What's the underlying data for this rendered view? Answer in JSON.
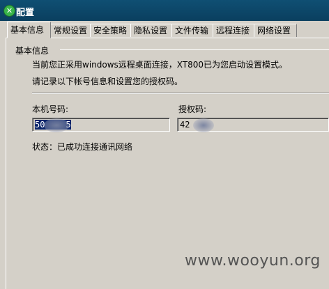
{
  "window": {
    "title": "配置"
  },
  "tabs": [
    {
      "label": "基本信息",
      "active": true
    },
    {
      "label": "常规设置",
      "active": false
    },
    {
      "label": "安全策略",
      "active": false
    },
    {
      "label": "隐私设置",
      "active": false
    },
    {
      "label": "文件传输",
      "active": false
    },
    {
      "label": "远程连接",
      "active": false
    },
    {
      "label": "网络设置",
      "active": false
    }
  ],
  "basic_info": {
    "group_title": "基本信息",
    "notice_line1": "当前您正采用windows远程桌面连接，XT800已为您启动设置模式。",
    "notice_line2": "请记录以下帐号信息和设置您的授权码。",
    "machine_code_label": "本机号码:",
    "machine_code_value_start": "50",
    "machine_code_value_end": "5",
    "auth_code_label": "授权码:",
    "auth_code_value": "42",
    "status_text": "状态：已成功连接通讯网络"
  },
  "watermark": "www.wooyun.org"
}
